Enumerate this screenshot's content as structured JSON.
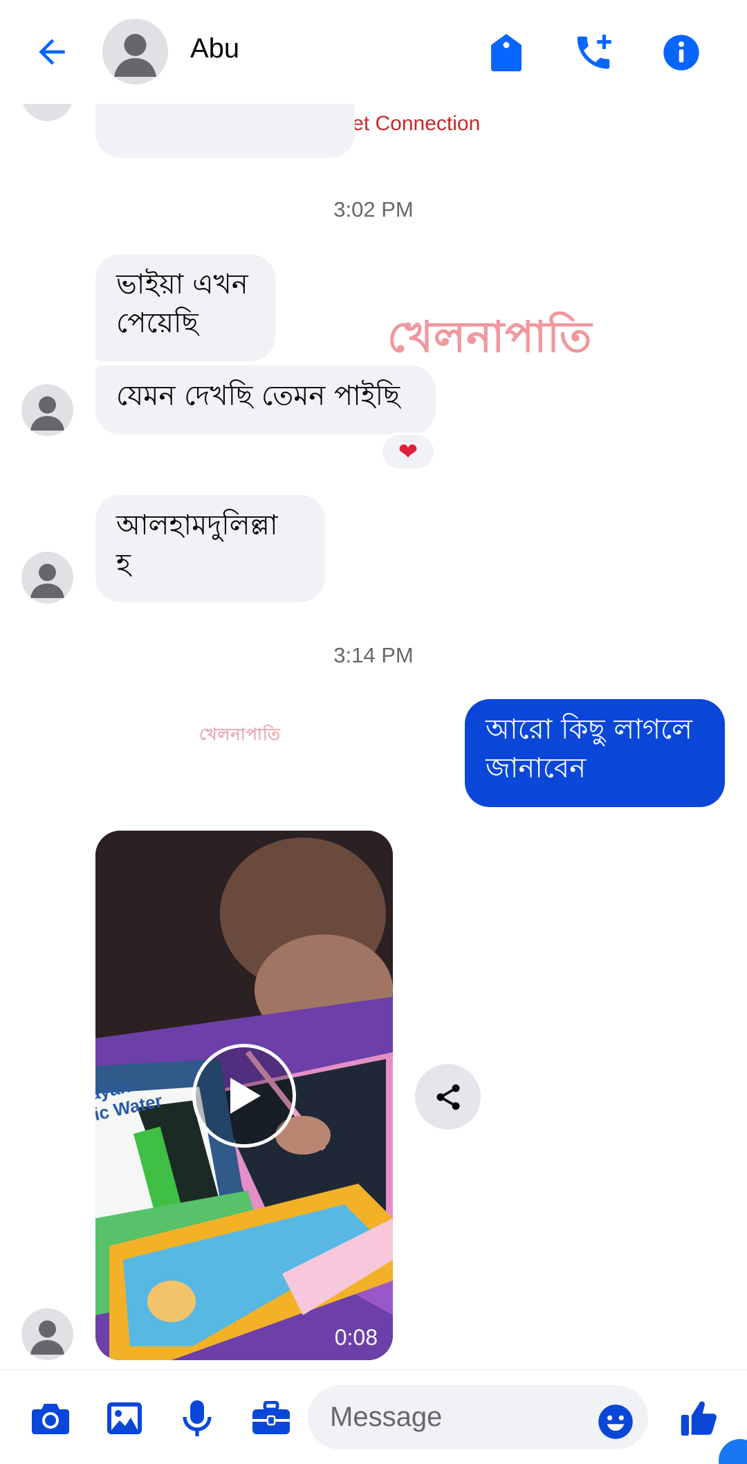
{
  "header": {
    "contact_name": "Abu",
    "back_icon": "arrow-left-icon",
    "tag_icon": "tag-icon",
    "call_icon": "add-call-icon",
    "info_icon": "info-icon"
  },
  "status": {
    "text": "No Internet Connection"
  },
  "messages": {
    "ts1": "3:02 PM",
    "m1": "ভাইয়া এখন\nপেয়েছি",
    "m2": "যেমন দেখছি তেমন পাইছি",
    "m2_reaction": "❤",
    "m3": "আলহামদুলিল্লা\nহ",
    "ts2": "3:14 PM",
    "m4": "আরো কিছু লাগলে\nজানাবেন"
  },
  "watermarks": {
    "large": "খেলনাপাতি",
    "small": "খেলনাপাতি"
  },
  "video": {
    "duration": "0:08",
    "overlay_text": "ayan\nic Water"
  },
  "composer": {
    "placeholder": "Message",
    "icons": [
      "camera-icon",
      "image-icon",
      "microphone-icon",
      "briefcase-icon",
      "emoji-icon",
      "thumbs-up-icon"
    ]
  },
  "colors": {
    "accent": "#0866ff",
    "outgoing_bubble": "#0a47d9",
    "incoming_bubble": "#f0f2f5",
    "alert": "#c62828"
  }
}
